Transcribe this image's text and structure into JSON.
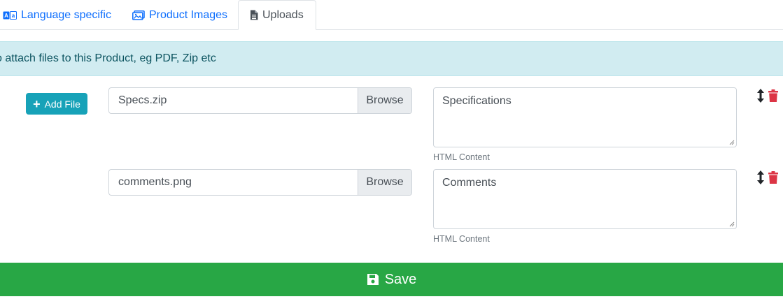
{
  "tabs": [
    {
      "label": "Language specific",
      "icon": "language-icon"
    },
    {
      "label": "Product Images",
      "icon": "images-icon"
    },
    {
      "label": "Uploads",
      "icon": "file-icon",
      "active": true
    }
  ],
  "info_text": "o attach files to this Product, eg PDF, Zip etc",
  "add_file_label": "Add File",
  "browse_label": "Browse",
  "uploads": [
    {
      "file_name": "Specs.zip",
      "content": "Specifications",
      "hint": "HTML Content"
    },
    {
      "file_name": "comments.png",
      "content": "Comments",
      "hint": "HTML Content"
    }
  ],
  "save_label": "Save",
  "colors": {
    "link": "#0d6efd",
    "info_bg": "#d1ecf1",
    "add_button": "#17a2b8",
    "save_bar": "#28a745",
    "delete": "#dc3545"
  }
}
